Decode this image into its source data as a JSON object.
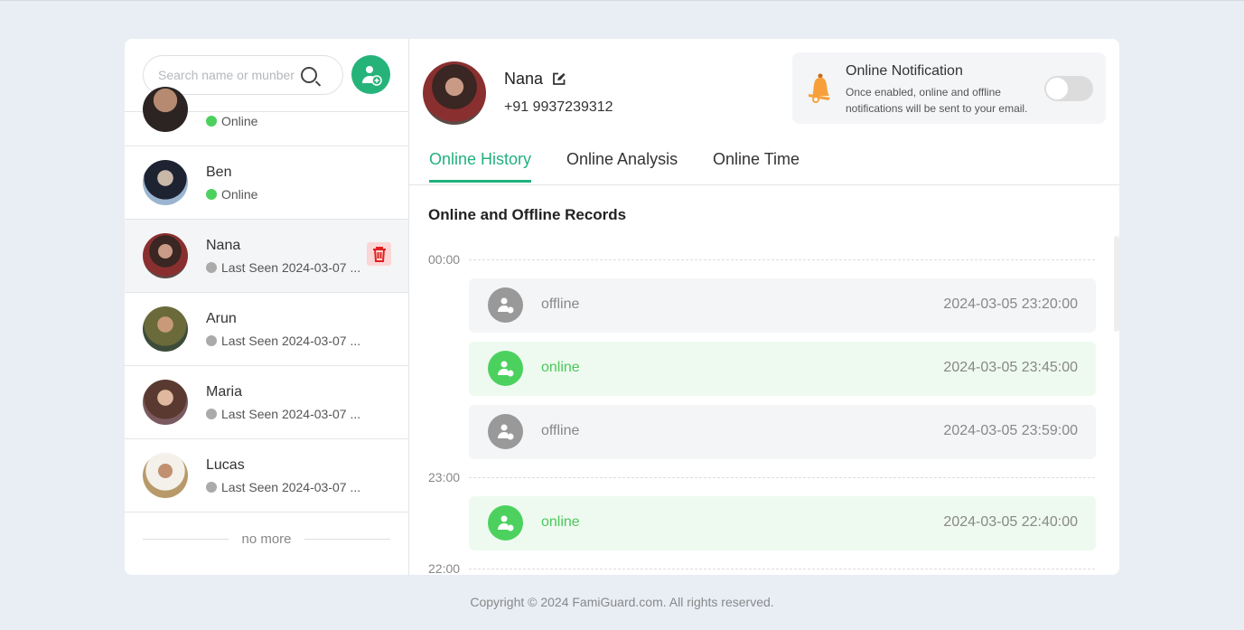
{
  "sidebar": {
    "search_placeholder": "Search name or munber",
    "contacts": [
      {
        "name": "",
        "status": "Online",
        "online": true
      },
      {
        "name": "Ben",
        "status": "Online",
        "online": true
      },
      {
        "name": "Nana",
        "status": "Last Seen 2024-03-07 ...",
        "online": false,
        "selected": true
      },
      {
        "name": "Arun",
        "status": "Last Seen 2024-03-07 ...",
        "online": false
      },
      {
        "name": "Maria",
        "status": "Last Seen 2024-03-07 ...",
        "online": false
      },
      {
        "name": "Lucas",
        "status": "Last Seen 2024-03-07 ...",
        "online": false
      }
    ],
    "no_more": "no more"
  },
  "profile": {
    "name": "Nana",
    "phone": "+91 9937239312"
  },
  "notification": {
    "title": "Online Notification",
    "description": "Once enabled, online and offline notifications will be sent to your email.",
    "enabled": false
  },
  "tabs": [
    {
      "label": "Online History",
      "active": true
    },
    {
      "label": "Online Analysis"
    },
    {
      "label": "Online Time"
    }
  ],
  "records": {
    "title": "Online and Offline Records",
    "hours": [
      "00:00",
      "23:00",
      "22:00"
    ],
    "items": [
      {
        "status": "offline",
        "time": "2024-03-05 23:20:00"
      },
      {
        "status": "online",
        "time": "2024-03-05 23:45:00"
      },
      {
        "status": "offline",
        "time": "2024-03-05 23:59:00"
      },
      {
        "status": "online",
        "time": "2024-03-05 22:40:00"
      }
    ]
  },
  "colors": {
    "accent": "#22b07d",
    "online": "#4cd15f",
    "offline": "#999999",
    "delete": "#e02020"
  },
  "footer": "Copyright © 2024 FamiGuard.com. All rights reserved."
}
